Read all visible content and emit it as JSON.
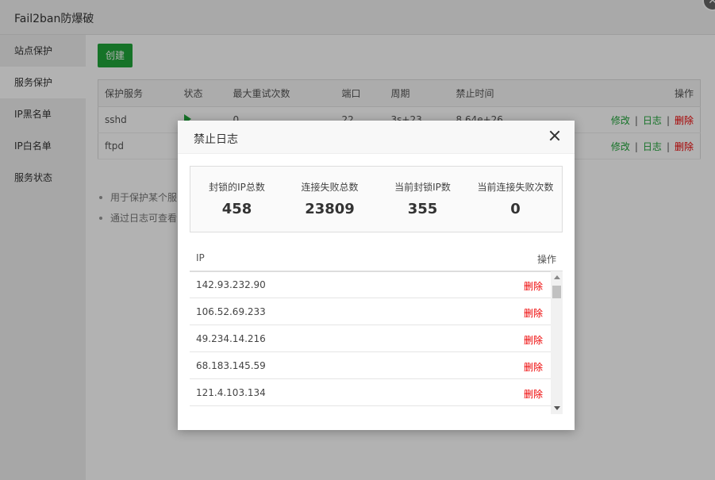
{
  "window": {
    "title": "Fail2ban防爆破"
  },
  "sidebar": {
    "items": [
      {
        "label": "站点保护",
        "active": false
      },
      {
        "label": "服务保护",
        "active": true
      },
      {
        "label": "IP黑名单",
        "active": false
      },
      {
        "label": "IP白名单",
        "active": false
      },
      {
        "label": "服务状态",
        "active": false
      }
    ]
  },
  "main": {
    "create_label": "创建",
    "table": {
      "headers": {
        "service": "保护服务",
        "status": "状态",
        "retry": "最大重试次数",
        "port": "端口",
        "period": "周期",
        "bantime": "禁止时间",
        "ops": "操作"
      },
      "rows": [
        {
          "service": "sshd",
          "retry": "0",
          "port": "22",
          "period": "3s+23",
          "bantime": "8.64e+26",
          "edit": "修改",
          "log": "日志",
          "del": "删除"
        },
        {
          "service": "ftpd",
          "retry": "",
          "port": "",
          "period": "",
          "bantime": "",
          "edit": "修改",
          "log": "日志",
          "del": "删除"
        }
      ]
    },
    "tips": [
      "用于保护某个服",
      "通过日志可查看"
    ]
  },
  "modal": {
    "title": "禁止日志",
    "stats": [
      {
        "label": "封锁的IP总数",
        "value": "458"
      },
      {
        "label": "连接失败总数",
        "value": "23809"
      },
      {
        "label": "当前封锁IP数",
        "value": "355"
      },
      {
        "label": "当前连接失败次数",
        "value": "0"
      }
    ],
    "list_headers": {
      "ip": "IP",
      "ops": "操作"
    },
    "rows": [
      {
        "ip": "142.93.232.90",
        "action": "删除"
      },
      {
        "ip": "106.52.69.233",
        "action": "删除"
      },
      {
        "ip": "49.234.14.216",
        "action": "删除"
      },
      {
        "ip": "68.183.145.59",
        "action": "删除"
      },
      {
        "ip": "121.4.103.134",
        "action": "删除"
      }
    ]
  }
}
